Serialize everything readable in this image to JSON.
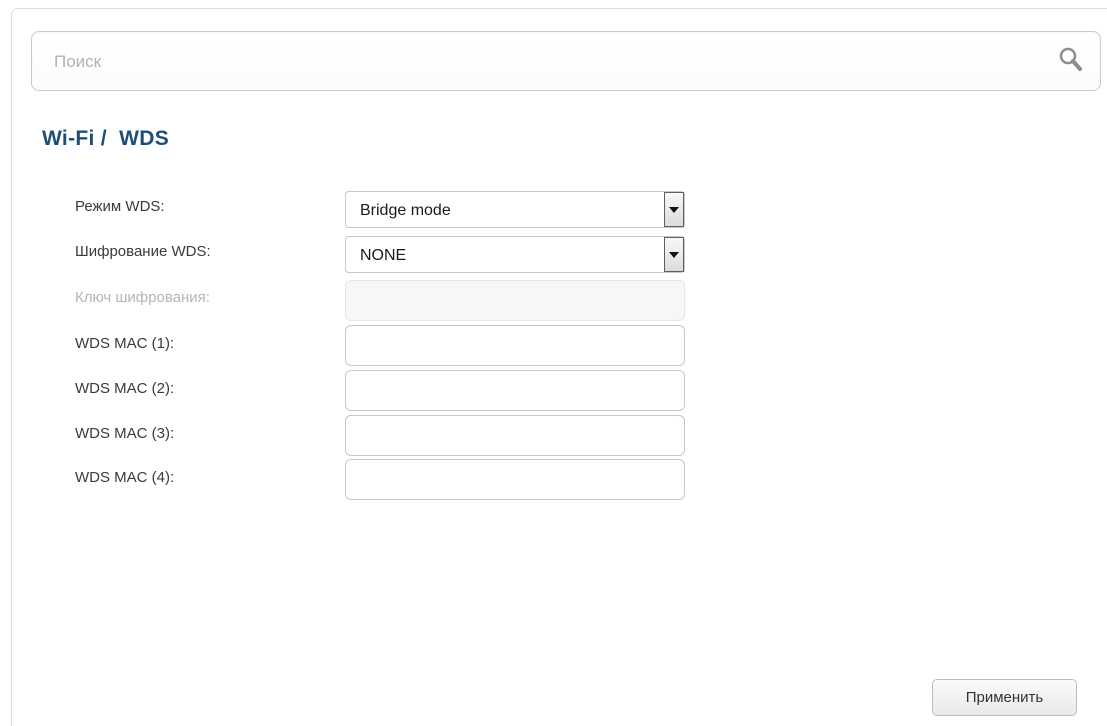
{
  "search": {
    "placeholder": "Поиск",
    "icon": "search-icon"
  },
  "page": {
    "title": "Wi-Fi /  WDS"
  },
  "form": {
    "wds_mode": {
      "label": "Режим WDS:",
      "value": "Bridge mode"
    },
    "wds_encryption": {
      "label": "Шифрование WDS:",
      "value": "NONE"
    },
    "encryption_key": {
      "label": "Ключ шифрования:",
      "value": ""
    },
    "mac1": {
      "label": "WDS MAC (1):",
      "value": ""
    },
    "mac2": {
      "label": "WDS MAC (2):",
      "value": ""
    },
    "mac3": {
      "label": "WDS MAC (3):",
      "value": ""
    },
    "mac4": {
      "label": "WDS MAC (4):",
      "value": ""
    }
  },
  "actions": {
    "apply_label": "Применить"
  },
  "colors": {
    "title": "#1e4d76",
    "label": "#3a3a3a",
    "disabled_label": "#b5b5b5"
  }
}
